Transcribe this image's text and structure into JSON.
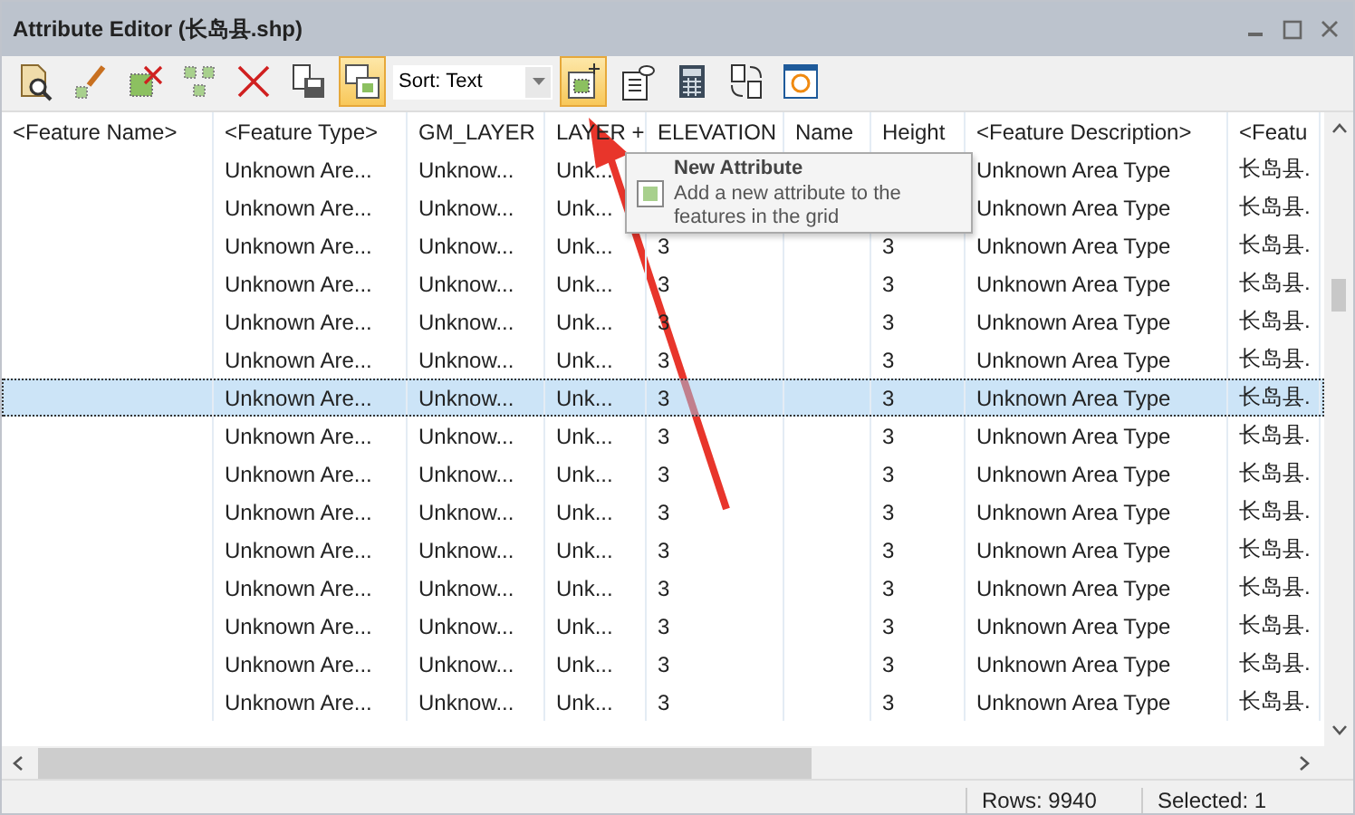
{
  "window": {
    "title": "Attribute Editor (长岛县.shp)"
  },
  "toolbar": [
    {
      "kind": "zoom",
      "selected": false
    },
    {
      "kind": "edit",
      "selected": false
    },
    {
      "kind": "delete-feature",
      "selected": false
    },
    {
      "kind": "select",
      "selected": false
    },
    {
      "kind": "delete",
      "selected": false
    },
    {
      "kind": "save",
      "selected": false
    },
    {
      "kind": "layout",
      "selected": true
    },
    {
      "kind": "sort",
      "value": "Sort: Text"
    },
    {
      "kind": "new-attribute",
      "selected": true
    },
    {
      "kind": "view",
      "selected": false
    },
    {
      "kind": "calculator",
      "selected": false
    },
    {
      "kind": "convert",
      "selected": false
    },
    {
      "kind": "refresh",
      "selected": false
    }
  ],
  "tooltip": {
    "title": "New Attribute",
    "text": "Add a new attribute to the features in the grid"
  },
  "table": {
    "columns": [
      "<Feature Name>",
      "<Feature Type>",
      "GM_LAYER",
      "LAYER +",
      "ELEVATION",
      "Name",
      "Height",
      "<Feature Description>",
      "<Featu"
    ],
    "rows": [
      {
        "selected": false,
        "cells": [
          "",
          "Unknown Are...",
          "Unknow...",
          "Unk...",
          "",
          "",
          "",
          "Unknown Area Type",
          "长岛县."
        ]
      },
      {
        "selected": false,
        "cells": [
          "",
          "Unknown Are...",
          "Unknow...",
          "Unk...",
          "",
          "",
          "",
          "Unknown Area Type",
          "长岛县."
        ]
      },
      {
        "selected": false,
        "cells": [
          "",
          "Unknown Are...",
          "Unknow...",
          "Unk...",
          "3",
          "",
          "3",
          "Unknown Area Type",
          "长岛县."
        ]
      },
      {
        "selected": false,
        "cells": [
          "",
          "Unknown Are...",
          "Unknow...",
          "Unk...",
          "3",
          "",
          "3",
          "Unknown Area Type",
          "长岛县."
        ]
      },
      {
        "selected": false,
        "cells": [
          "",
          "Unknown Are...",
          "Unknow...",
          "Unk...",
          "3",
          "",
          "3",
          "Unknown Area Type",
          "长岛县."
        ]
      },
      {
        "selected": false,
        "cells": [
          "",
          "Unknown Are...",
          "Unknow...",
          "Unk...",
          "3",
          "",
          "3",
          "Unknown Area Type",
          "长岛县."
        ]
      },
      {
        "selected": true,
        "cells": [
          "",
          "Unknown Are...",
          "Unknow...",
          "Unk...",
          "3",
          "",
          "3",
          "Unknown Area Type",
          "长岛县."
        ]
      },
      {
        "selected": false,
        "cells": [
          "",
          "Unknown Are...",
          "Unknow...",
          "Unk...",
          "3",
          "",
          "3",
          "Unknown Area Type",
          "长岛县."
        ]
      },
      {
        "selected": false,
        "cells": [
          "",
          "Unknown Are...",
          "Unknow...",
          "Unk...",
          "3",
          "",
          "3",
          "Unknown Area Type",
          "长岛县."
        ]
      },
      {
        "selected": false,
        "cells": [
          "",
          "Unknown Are...",
          "Unknow...",
          "Unk...",
          "3",
          "",
          "3",
          "Unknown Area Type",
          "长岛县."
        ]
      },
      {
        "selected": false,
        "cells": [
          "",
          "Unknown Are...",
          "Unknow...",
          "Unk...",
          "3",
          "",
          "3",
          "Unknown Area Type",
          "长岛县."
        ]
      },
      {
        "selected": false,
        "cells": [
          "",
          "Unknown Are...",
          "Unknow...",
          "Unk...",
          "3",
          "",
          "3",
          "Unknown Area Type",
          "长岛县."
        ]
      },
      {
        "selected": false,
        "cells": [
          "",
          "Unknown Are...",
          "Unknow...",
          "Unk...",
          "3",
          "",
          "3",
          "Unknown Area Type",
          "长岛县."
        ]
      },
      {
        "selected": false,
        "cells": [
          "",
          "Unknown Are...",
          "Unknow...",
          "Unk...",
          "3",
          "",
          "3",
          "Unknown Area Type",
          "长岛县."
        ]
      },
      {
        "selected": false,
        "cells": [
          "",
          "Unknown Are...",
          "Unknow...",
          "Unk...",
          "3",
          "",
          "3",
          "Unknown Area Type",
          "长岛县."
        ]
      }
    ]
  },
  "status_bar": [
    "Rows: 9940",
    "Selected: 1"
  ]
}
